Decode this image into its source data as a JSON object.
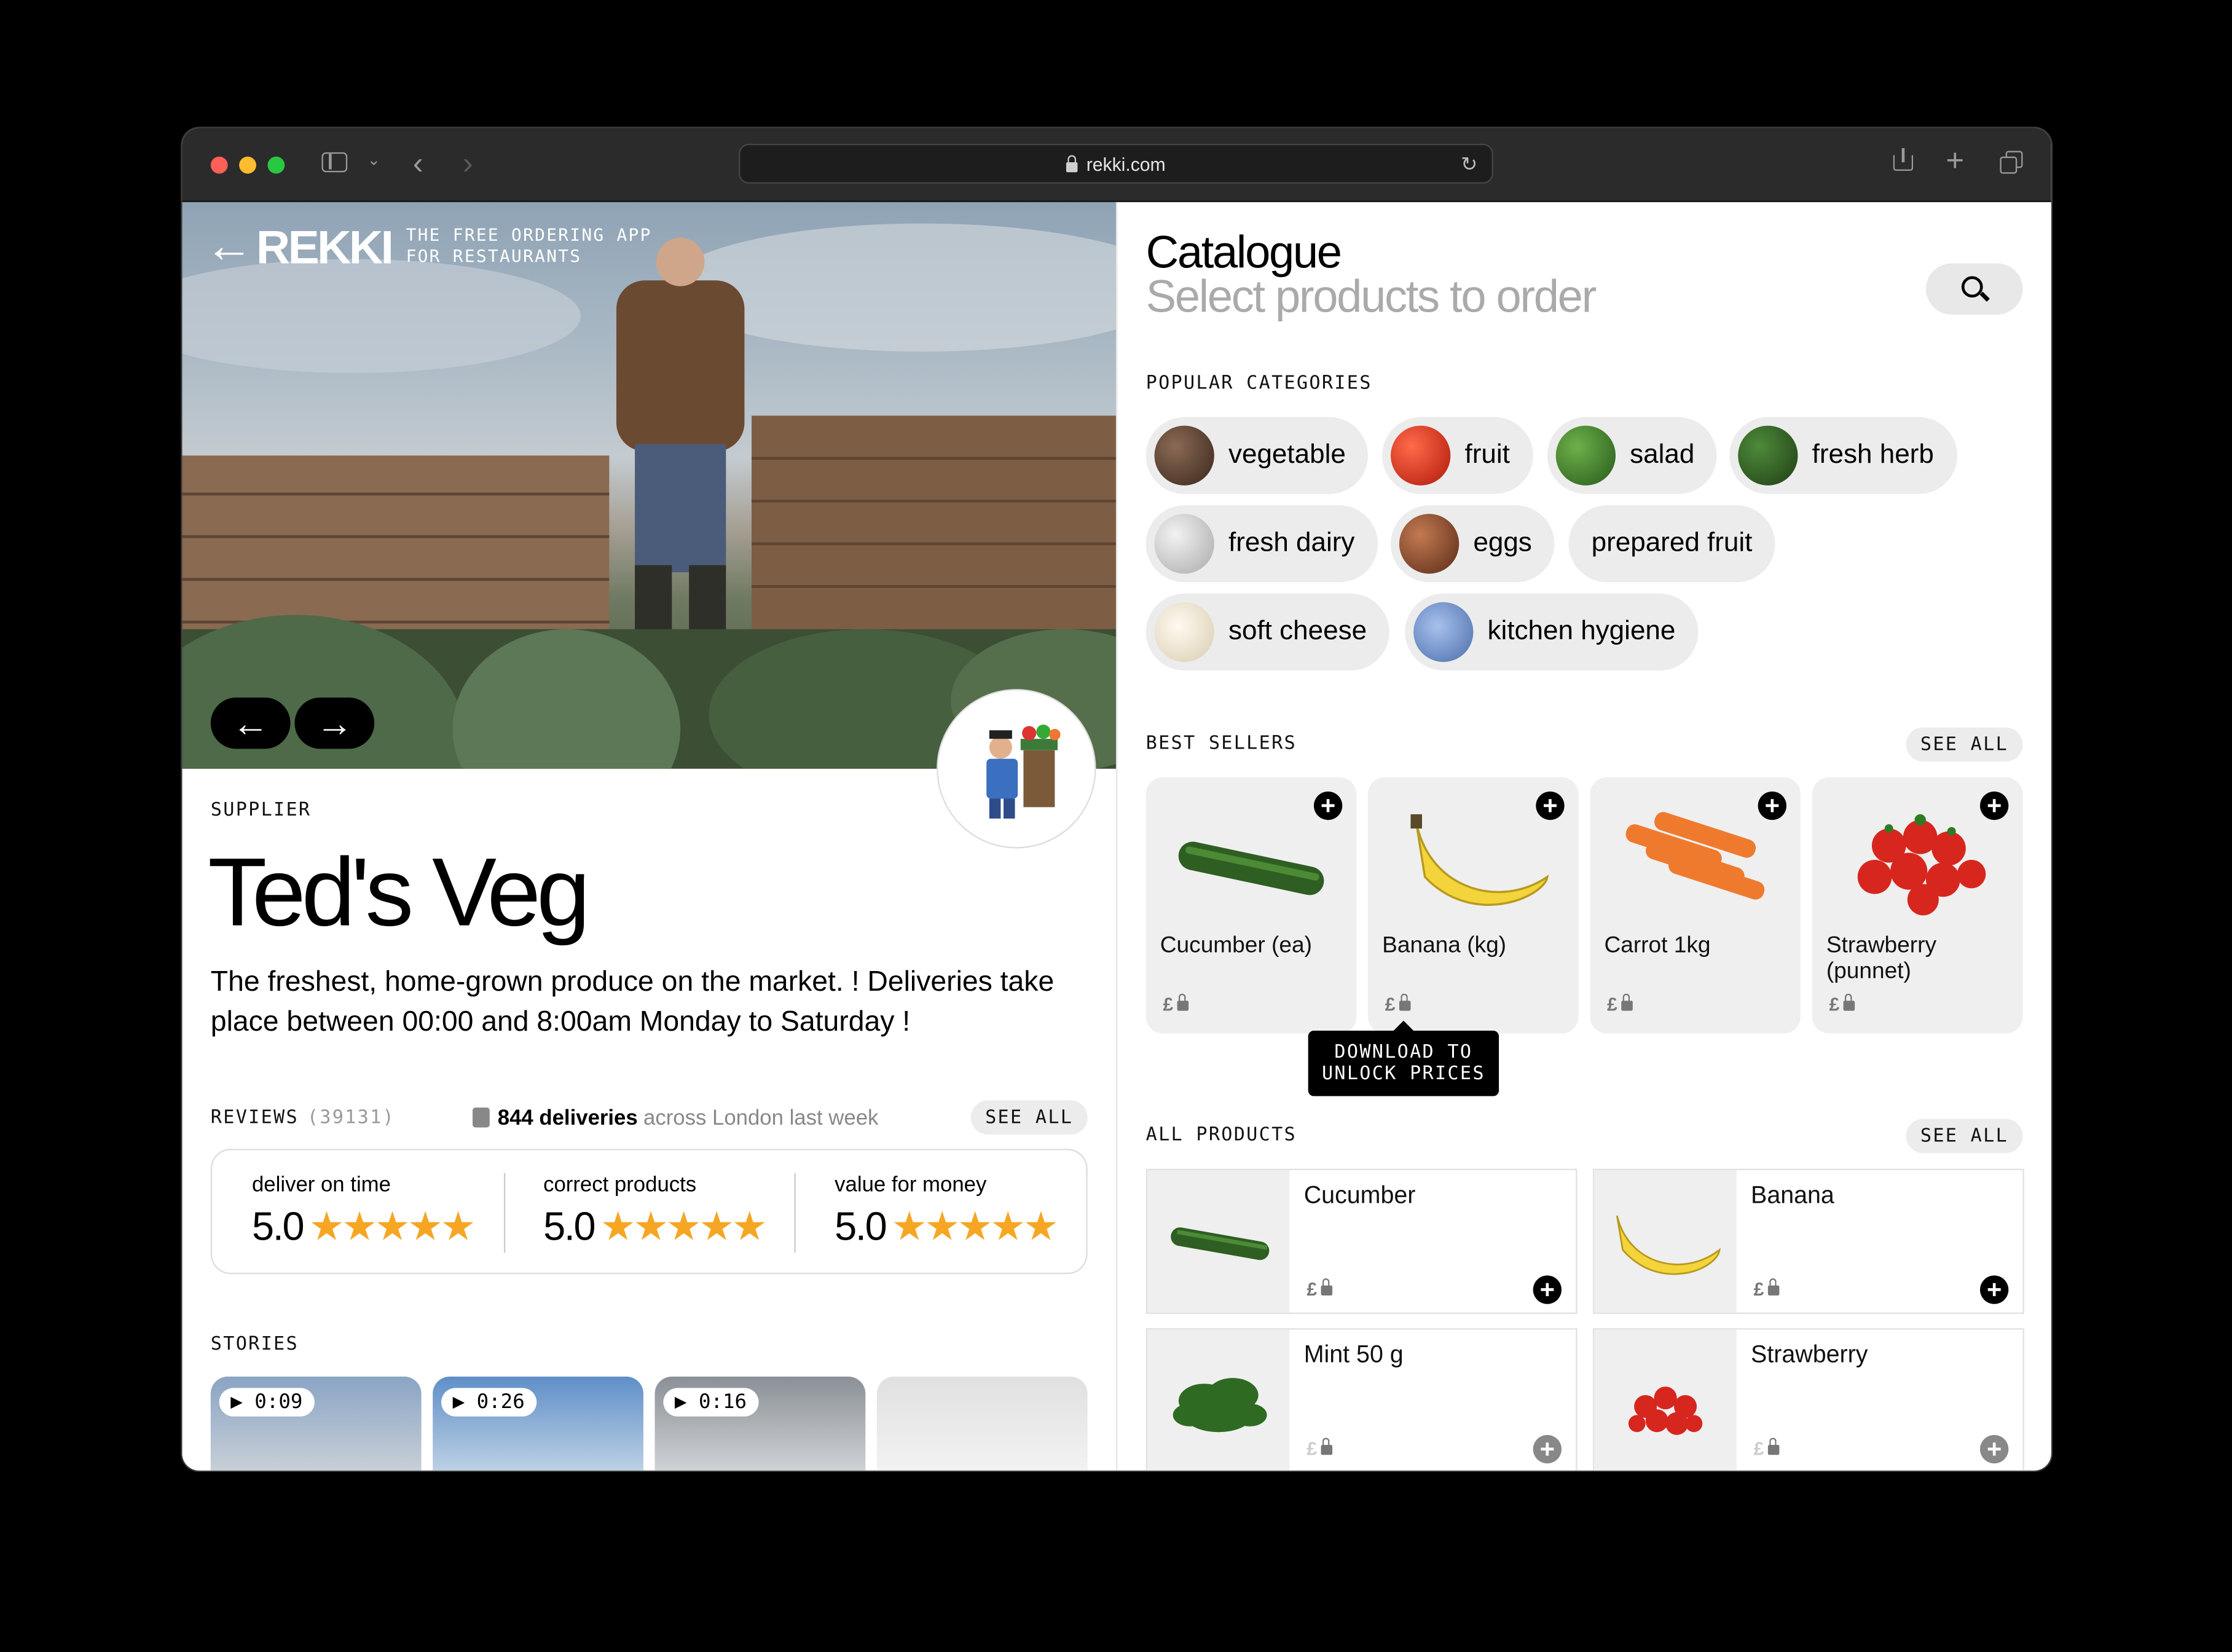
{
  "browser": {
    "url": "rekki.com"
  },
  "brand": {
    "wordmark": "REKKI",
    "tagline_line1": "THE FREE ORDERING APP",
    "tagline_line2": "FOR RESTAURANTS"
  },
  "supplier": {
    "eyebrow": "SUPPLIER",
    "name": "Ted's Veg",
    "description": "The freshest, home-grown produce on the market. ! Deliveries take place between 00:00 and 8:00am Monday to Saturday !",
    "reviews_label": "REVIEWS",
    "reviews_count": "(39131)",
    "deliveries_bold": "844 deliveries",
    "deliveries_muted": "across London last week",
    "see_all": "SEE ALL",
    "ratings": [
      {
        "label": "deliver on time",
        "value": "5.0",
        "stars": "★★★★★"
      },
      {
        "label": "correct products",
        "value": "5.0",
        "stars": "★★★★★"
      },
      {
        "label": "value for money",
        "value": "5.0",
        "stars": "★★★★★"
      }
    ],
    "stories_label": "STORIES",
    "stories": [
      {
        "duration": "▶ 0:09"
      },
      {
        "duration": "▶ 0:26"
      },
      {
        "duration": "▶ 0:16"
      }
    ]
  },
  "catalogue": {
    "title": "Catalogue",
    "subtitle": "Select products to order",
    "popular_label": "POPULAR CATEGORIES",
    "categories": [
      {
        "label": "vegetable",
        "color": "#4a3426"
      },
      {
        "label": "fruit",
        "color": "#d8321c"
      },
      {
        "label": "salad",
        "color": "#3f7a2a"
      },
      {
        "label": "fresh herb",
        "color": "#2f5e22"
      },
      {
        "label": "fresh dairy",
        "color": "#c9c9c9"
      },
      {
        "label": "eggs",
        "color": "#8b4a2c"
      },
      {
        "label": "prepared fruit",
        "color": ""
      },
      {
        "label": "soft cheese",
        "color": "#efe8d8"
      },
      {
        "label": "kitchen hygiene",
        "color": "#6d8fc9"
      }
    ],
    "best_label": "BEST SELLERS",
    "see_all": "SEE ALL",
    "best_sellers": [
      {
        "name": "Cucumber (ea)",
        "price": "£"
      },
      {
        "name": "Banana (kg)",
        "price": "£"
      },
      {
        "name": "Carrot 1kg",
        "price": "£"
      },
      {
        "name": "Strawberry (punnet)",
        "price": "£"
      }
    ],
    "tooltip_line1": "DOWNLOAD TO",
    "tooltip_line2": "UNLOCK PRICES",
    "all_label": "ALL PRODUCTS",
    "all_products": [
      {
        "name": "Cucumber",
        "price": "£"
      },
      {
        "name": "Banana",
        "price": "£"
      },
      {
        "name": "Mint 50 g",
        "price": "£"
      },
      {
        "name": "Strawberry",
        "price": "£"
      }
    ]
  }
}
